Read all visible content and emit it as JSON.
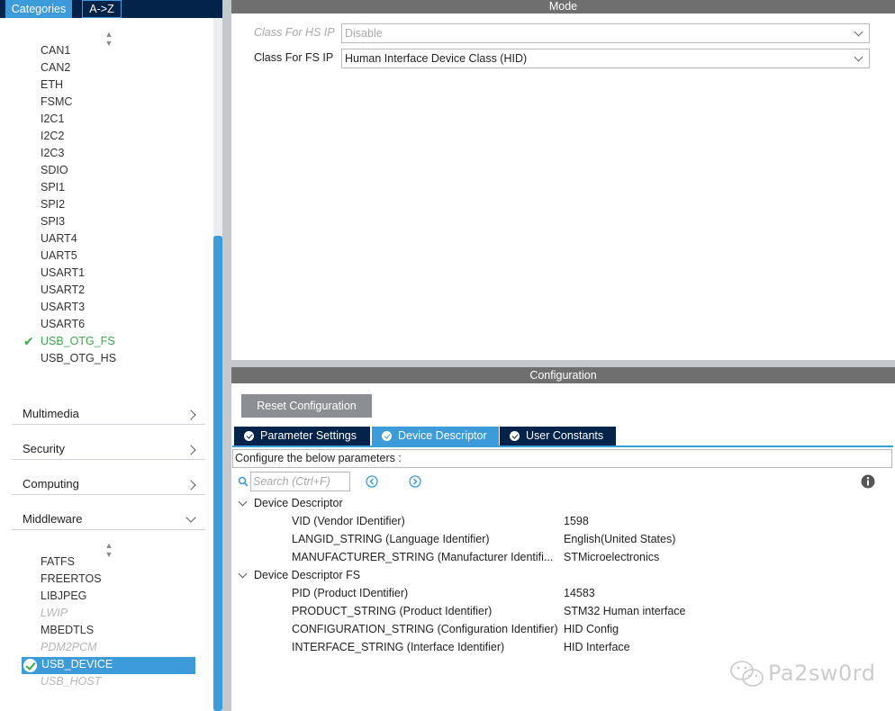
{
  "left_panel": {
    "tabs": {
      "categories": "Categories",
      "az": "A->Z"
    },
    "connectivity_items": [
      {
        "label": "CAN1",
        "state": "normal"
      },
      {
        "label": "CAN2",
        "state": "normal"
      },
      {
        "label": "ETH",
        "state": "normal"
      },
      {
        "label": "FSMC",
        "state": "normal"
      },
      {
        "label": "I2C1",
        "state": "normal"
      },
      {
        "label": "I2C2",
        "state": "normal"
      },
      {
        "label": "I2C3",
        "state": "normal"
      },
      {
        "label": "SDIO",
        "state": "normal"
      },
      {
        "label": "SPI1",
        "state": "normal"
      },
      {
        "label": "SPI2",
        "state": "normal"
      },
      {
        "label": "SPI3",
        "state": "normal"
      },
      {
        "label": "UART4",
        "state": "normal"
      },
      {
        "label": "UART5",
        "state": "normal"
      },
      {
        "label": "USART1",
        "state": "normal"
      },
      {
        "label": "USART2",
        "state": "normal"
      },
      {
        "label": "USART3",
        "state": "normal"
      },
      {
        "label": "USART6",
        "state": "normal"
      },
      {
        "label": "USB_OTG_FS",
        "state": "active"
      },
      {
        "label": "USB_OTG_HS",
        "state": "normal"
      }
    ],
    "categories": [
      {
        "label": "Multimedia",
        "expanded": false
      },
      {
        "label": "Security",
        "expanded": false
      },
      {
        "label": "Computing",
        "expanded": false
      },
      {
        "label": "Middleware",
        "expanded": true
      }
    ],
    "middleware_items": [
      {
        "label": "FATFS",
        "state": "normal"
      },
      {
        "label": "FREERTOS",
        "state": "normal"
      },
      {
        "label": "LIBJPEG",
        "state": "normal"
      },
      {
        "label": "LWIP",
        "state": "disabled"
      },
      {
        "label": "MBEDTLS",
        "state": "normal"
      },
      {
        "label": "PDM2PCM",
        "state": "disabled"
      },
      {
        "label": "USB_DEVICE",
        "state": "selected"
      },
      {
        "label": "USB_HOST",
        "state": "disabled"
      }
    ]
  },
  "mode": {
    "title": "Mode",
    "hs_label": "Class For HS IP",
    "hs_value": "Disable",
    "fs_label": "Class For FS IP",
    "fs_value": "Human Interface Device Class (HID)"
  },
  "configuration": {
    "title": "Configuration",
    "reset_label": "Reset Configuration",
    "tabs": [
      "Parameter Settings",
      "Device Descriptor",
      "User Constants"
    ],
    "active_tab": 1,
    "hint": "Configure the below parameters :",
    "search_placeholder": "Search (Ctrl+F)",
    "groups": [
      {
        "label": "Device Descriptor",
        "params": [
          {
            "name": "VID (Vendor IDentifier)",
            "value": "1598"
          },
          {
            "name": "LANGID_STRING (Language Identifier)",
            "value": "English(United States)"
          },
          {
            "name": "MANUFACTURER_STRING (Manufacturer Identifi...",
            "value": "STMicroelectronics"
          }
        ]
      },
      {
        "label": "Device Descriptor FS",
        "params": [
          {
            "name": "PID (Product IDentifier)",
            "value": "14583"
          },
          {
            "name": "PRODUCT_STRING (Product Identifier)",
            "value": "STM32 Human interface"
          },
          {
            "name": "CONFIGURATION_STRING (Configuration Identifier)",
            "value": "HID Config"
          },
          {
            "name": "INTERFACE_STRING (Interface Identifier)",
            "value": "HID Interface"
          }
        ]
      }
    ]
  },
  "watermark": "Pa2sw0rd",
  "colors": {
    "navy": "#03234b",
    "accent_blue": "#3c9bd8",
    "active_green": "#39a84a",
    "header_gray": "#6f6f6f"
  }
}
